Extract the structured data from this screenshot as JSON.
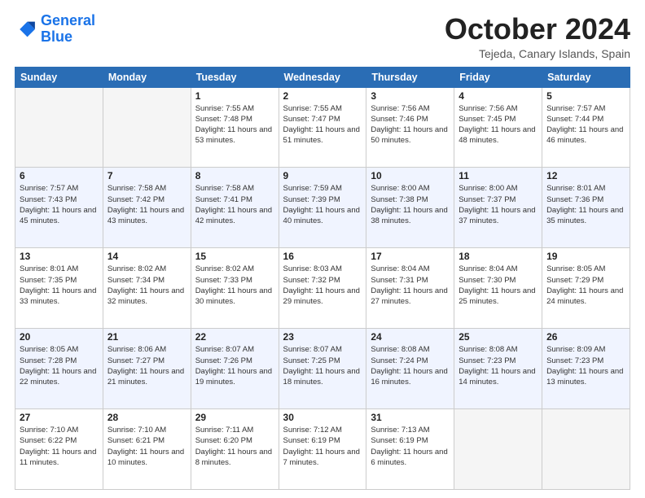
{
  "logo": {
    "line1": "General",
    "line2": "Blue"
  },
  "header": {
    "month": "October 2024",
    "location": "Tejeda, Canary Islands, Spain"
  },
  "days_of_week": [
    "Sunday",
    "Monday",
    "Tuesday",
    "Wednesday",
    "Thursday",
    "Friday",
    "Saturday"
  ],
  "weeks": [
    [
      {
        "day": "",
        "info": ""
      },
      {
        "day": "",
        "info": ""
      },
      {
        "day": "1",
        "info": "Sunrise: 7:55 AM\nSunset: 7:48 PM\nDaylight: 11 hours and 53 minutes."
      },
      {
        "day": "2",
        "info": "Sunrise: 7:55 AM\nSunset: 7:47 PM\nDaylight: 11 hours and 51 minutes."
      },
      {
        "day": "3",
        "info": "Sunrise: 7:56 AM\nSunset: 7:46 PM\nDaylight: 11 hours and 50 minutes."
      },
      {
        "day": "4",
        "info": "Sunrise: 7:56 AM\nSunset: 7:45 PM\nDaylight: 11 hours and 48 minutes."
      },
      {
        "day": "5",
        "info": "Sunrise: 7:57 AM\nSunset: 7:44 PM\nDaylight: 11 hours and 46 minutes."
      }
    ],
    [
      {
        "day": "6",
        "info": "Sunrise: 7:57 AM\nSunset: 7:43 PM\nDaylight: 11 hours and 45 minutes."
      },
      {
        "day": "7",
        "info": "Sunrise: 7:58 AM\nSunset: 7:42 PM\nDaylight: 11 hours and 43 minutes."
      },
      {
        "day": "8",
        "info": "Sunrise: 7:58 AM\nSunset: 7:41 PM\nDaylight: 11 hours and 42 minutes."
      },
      {
        "day": "9",
        "info": "Sunrise: 7:59 AM\nSunset: 7:39 PM\nDaylight: 11 hours and 40 minutes."
      },
      {
        "day": "10",
        "info": "Sunrise: 8:00 AM\nSunset: 7:38 PM\nDaylight: 11 hours and 38 minutes."
      },
      {
        "day": "11",
        "info": "Sunrise: 8:00 AM\nSunset: 7:37 PM\nDaylight: 11 hours and 37 minutes."
      },
      {
        "day": "12",
        "info": "Sunrise: 8:01 AM\nSunset: 7:36 PM\nDaylight: 11 hours and 35 minutes."
      }
    ],
    [
      {
        "day": "13",
        "info": "Sunrise: 8:01 AM\nSunset: 7:35 PM\nDaylight: 11 hours and 33 minutes."
      },
      {
        "day": "14",
        "info": "Sunrise: 8:02 AM\nSunset: 7:34 PM\nDaylight: 11 hours and 32 minutes."
      },
      {
        "day": "15",
        "info": "Sunrise: 8:02 AM\nSunset: 7:33 PM\nDaylight: 11 hours and 30 minutes."
      },
      {
        "day": "16",
        "info": "Sunrise: 8:03 AM\nSunset: 7:32 PM\nDaylight: 11 hours and 29 minutes."
      },
      {
        "day": "17",
        "info": "Sunrise: 8:04 AM\nSunset: 7:31 PM\nDaylight: 11 hours and 27 minutes."
      },
      {
        "day": "18",
        "info": "Sunrise: 8:04 AM\nSunset: 7:30 PM\nDaylight: 11 hours and 25 minutes."
      },
      {
        "day": "19",
        "info": "Sunrise: 8:05 AM\nSunset: 7:29 PM\nDaylight: 11 hours and 24 minutes."
      }
    ],
    [
      {
        "day": "20",
        "info": "Sunrise: 8:05 AM\nSunset: 7:28 PM\nDaylight: 11 hours and 22 minutes."
      },
      {
        "day": "21",
        "info": "Sunrise: 8:06 AM\nSunset: 7:27 PM\nDaylight: 11 hours and 21 minutes."
      },
      {
        "day": "22",
        "info": "Sunrise: 8:07 AM\nSunset: 7:26 PM\nDaylight: 11 hours and 19 minutes."
      },
      {
        "day": "23",
        "info": "Sunrise: 8:07 AM\nSunset: 7:25 PM\nDaylight: 11 hours and 18 minutes."
      },
      {
        "day": "24",
        "info": "Sunrise: 8:08 AM\nSunset: 7:24 PM\nDaylight: 11 hours and 16 minutes."
      },
      {
        "day": "25",
        "info": "Sunrise: 8:08 AM\nSunset: 7:23 PM\nDaylight: 11 hours and 14 minutes."
      },
      {
        "day": "26",
        "info": "Sunrise: 8:09 AM\nSunset: 7:23 PM\nDaylight: 11 hours and 13 minutes."
      }
    ],
    [
      {
        "day": "27",
        "info": "Sunrise: 7:10 AM\nSunset: 6:22 PM\nDaylight: 11 hours and 11 minutes."
      },
      {
        "day": "28",
        "info": "Sunrise: 7:10 AM\nSunset: 6:21 PM\nDaylight: 11 hours and 10 minutes."
      },
      {
        "day": "29",
        "info": "Sunrise: 7:11 AM\nSunset: 6:20 PM\nDaylight: 11 hours and 8 minutes."
      },
      {
        "day": "30",
        "info": "Sunrise: 7:12 AM\nSunset: 6:19 PM\nDaylight: 11 hours and 7 minutes."
      },
      {
        "day": "31",
        "info": "Sunrise: 7:13 AM\nSunset: 6:19 PM\nDaylight: 11 hours and 6 minutes."
      },
      {
        "day": "",
        "info": ""
      },
      {
        "day": "",
        "info": ""
      }
    ]
  ]
}
